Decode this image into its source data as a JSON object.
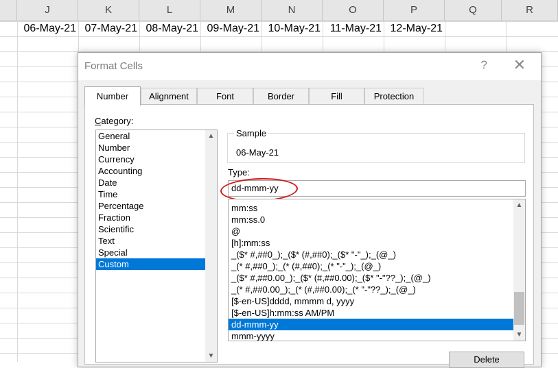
{
  "sheet": {
    "columns": [
      "J",
      "K",
      "L",
      "M",
      "N",
      "O",
      "P",
      "Q",
      "R"
    ],
    "row_values": [
      "06-May-21",
      "07-May-21",
      "08-May-21",
      "09-May-21",
      "10-May-21",
      "11-May-21",
      "12-May-21"
    ]
  },
  "dialog": {
    "title": "Format Cells",
    "help": "?",
    "close": "✕",
    "tabs": [
      "Number",
      "Alignment",
      "Font",
      "Border",
      "Fill",
      "Protection"
    ],
    "active_tab": "Number",
    "category_label_prefix": "C",
    "category_label_rest": "ategory:",
    "categories": [
      "General",
      "Number",
      "Currency",
      "Accounting",
      "Date",
      "Time",
      "Percentage",
      "Fraction",
      "Scientific",
      "Text",
      "Special",
      "Custom"
    ],
    "selected_category": "Custom",
    "sample_label": "Sample",
    "sample_value": "06-May-21",
    "type_label": "Type:",
    "type_value": "dd-mmm-yy",
    "type_list": [
      "mm:ss",
      "mm:ss.0",
      "@",
      "[h]:mm:ss",
      "_($* #,##0_);_($* (#,##0);_($* \"-\"_);_(@_)",
      "_(* #,##0_);_(* (#,##0);_(* \"-\"_);_(@_)",
      "_($* #,##0.00_);_($* (#,##0.00);_($* \"-\"??_);_(@_)",
      "_(* #,##0.00_);_(* (#,##0.00);_(* \"-\"??_);_(@_)",
      "[$-en-US]dddd, mmmm d, yyyy",
      "[$-en-US]h:mm:ss AM/PM",
      "dd-mmm-yy",
      "mmm-yyyy"
    ],
    "selected_type": "dd-mmm-yy",
    "delete_label": "Delete",
    "scroll_up": "▲",
    "scroll_down": "▼"
  }
}
